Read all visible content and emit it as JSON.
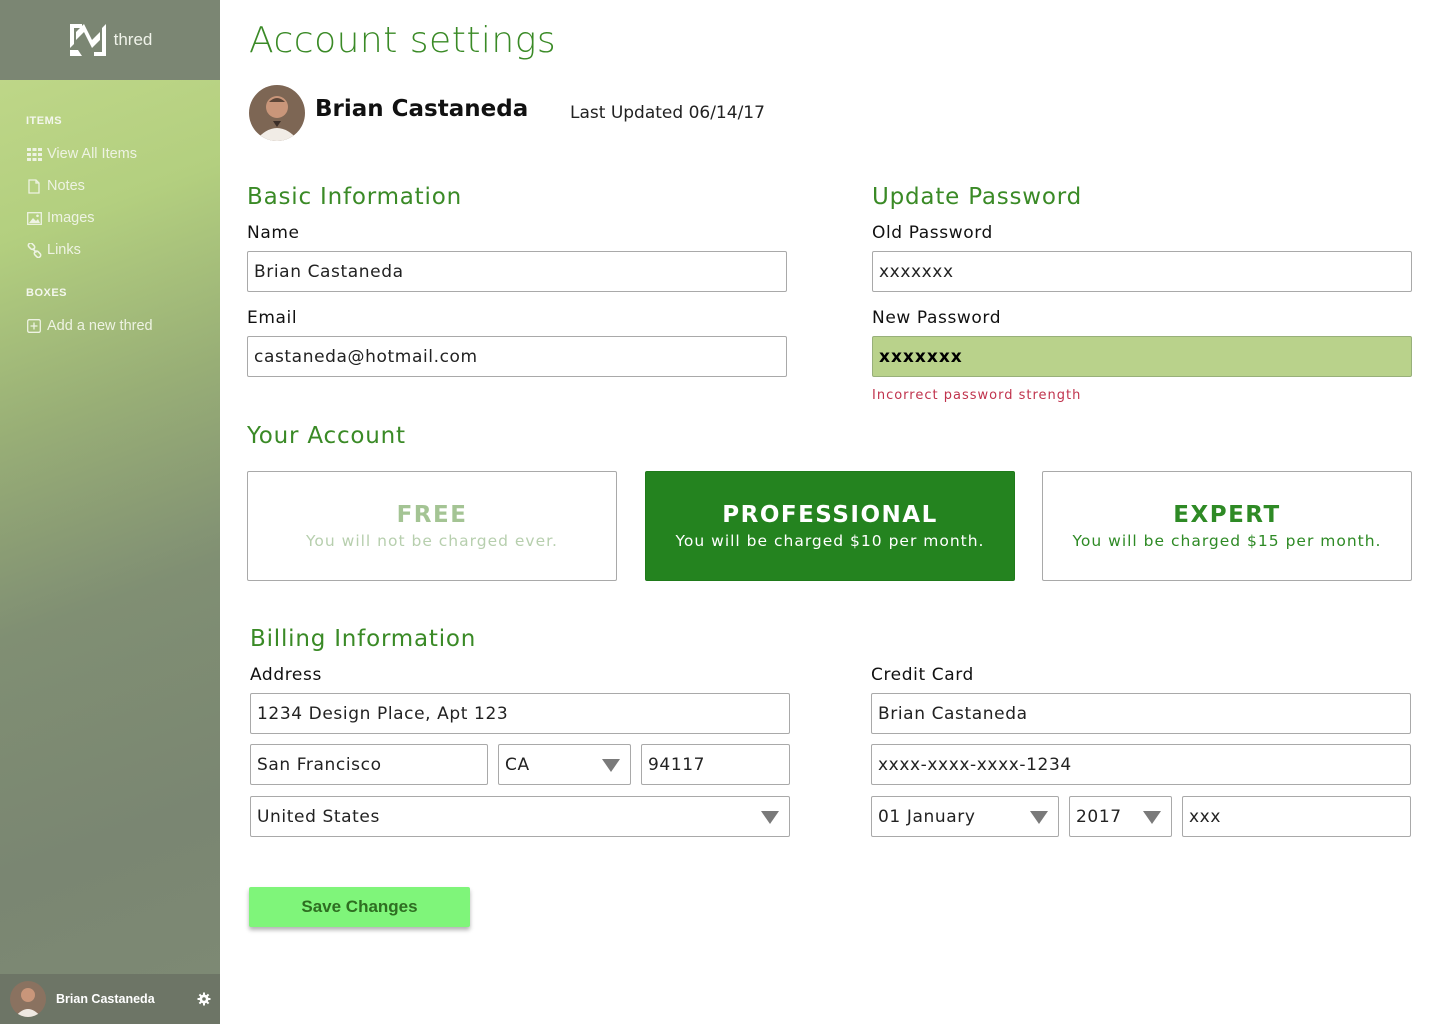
{
  "app": {
    "name": "thred"
  },
  "sidebar": {
    "sections": [
      {
        "heading": "ITEMS"
      },
      {
        "heading": "BOXES"
      }
    ],
    "items": [
      {
        "label": "View All Items",
        "icon": "grid-icon"
      },
      {
        "label": "Notes",
        "icon": "document-icon"
      },
      {
        "label": "Images",
        "icon": "image-icon"
      },
      {
        "label": "Links",
        "icon": "link-icon"
      },
      {
        "label": "Add a new thred",
        "icon": "plus-square-icon"
      }
    ],
    "user": {
      "name": "Brian Castaneda"
    }
  },
  "page": {
    "title": "Account settings",
    "profile": {
      "name": "Brian Castaneda",
      "last_updated": "Last Updated 06/14/17"
    }
  },
  "basic_info": {
    "title": "Basic Information",
    "name_label": "Name",
    "name_value": "Brian Castaneda",
    "email_label": "Email",
    "email_value": "castaneda@hotmail.com"
  },
  "password": {
    "title": "Update Password",
    "old_label": "Old Password",
    "old_value": "xxxxxxx",
    "new_label": "New Password",
    "new_value": "xxxxxxx",
    "error": "Incorrect password strength"
  },
  "account": {
    "title": "Your Account",
    "plans": [
      {
        "name": "FREE",
        "description": "You will not be charged ever."
      },
      {
        "name": "PROFESSIONAL",
        "description": "You will be charged $10 per month.",
        "selected": true
      },
      {
        "name": "EXPERT",
        "description": "You will be charged $15 per month."
      }
    ]
  },
  "billing": {
    "title": "Billing Information",
    "address_label": "Address",
    "street": "1234 Design Place, Apt 123",
    "city": "San Francisco",
    "state": "CA",
    "zip": "94117",
    "country": "United States",
    "card_label": "Credit Card",
    "card_name": "Brian Castaneda",
    "card_number": "xxxx-xxxx-xxxx-1234",
    "exp_month": "01 January",
    "exp_year": "2017",
    "cvv": "xxx"
  },
  "actions": {
    "save_label": "Save Changes"
  },
  "colors": {
    "accent_green": "#3a8a26",
    "selected_plan": "#24831f",
    "save_button": "#7ff57a",
    "error": "#c0334d",
    "highlight_input": "#b9d28b"
  }
}
